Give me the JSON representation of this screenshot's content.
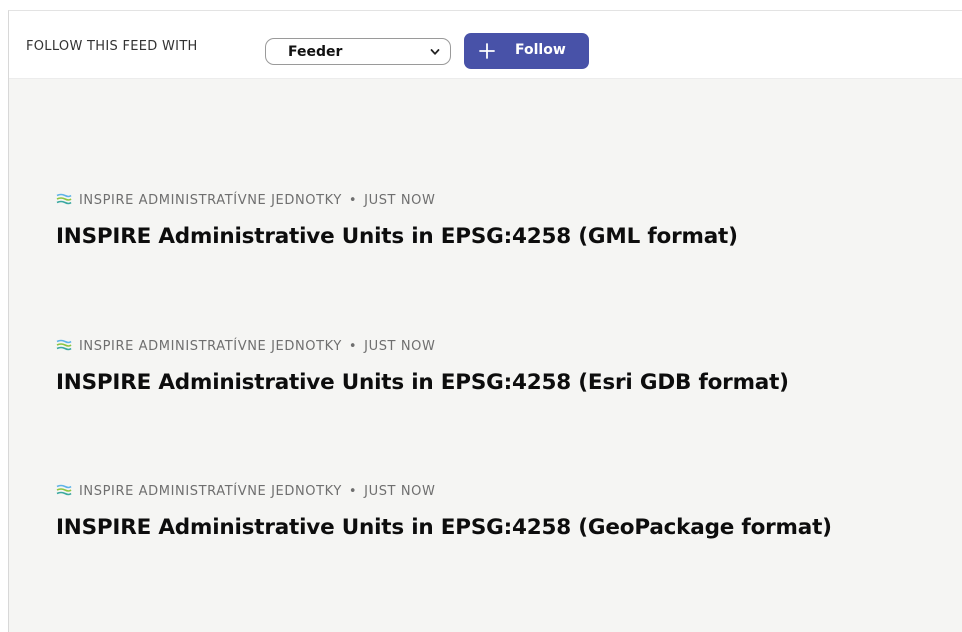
{
  "toolbar": {
    "follow_label": "FOLLOW THIS FEED WITH",
    "reader_select_value": "Feeder",
    "follow_button_label": "Follow"
  },
  "colors": {
    "follow_button_bg": "#4852a8",
    "content_bg": "#f5f5f3",
    "feed_icon_colors": [
      "#5fb3e8",
      "#8dc641",
      "#3aa8a0"
    ]
  },
  "icons": {
    "feed": "feed-source-icon",
    "select": "chevron-down-icon",
    "follow": "plus-icon"
  },
  "items": [
    {
      "source": "INSPIRE ADMINISTRATÍVNE JEDNOTKY",
      "separator": "•",
      "time": "JUST NOW",
      "title": "INSPIRE Administrative Units in EPSG:4258 (GML format)"
    },
    {
      "source": "INSPIRE ADMINISTRATÍVNE JEDNOTKY",
      "separator": "•",
      "time": "JUST NOW",
      "title": "INSPIRE Administrative Units in EPSG:4258 (Esri GDB format)"
    },
    {
      "source": "INSPIRE ADMINISTRATÍVNE JEDNOTKY",
      "separator": "•",
      "time": "JUST NOW",
      "title": "INSPIRE Administrative Units in EPSG:4258 (GeoPackage format)"
    }
  ]
}
